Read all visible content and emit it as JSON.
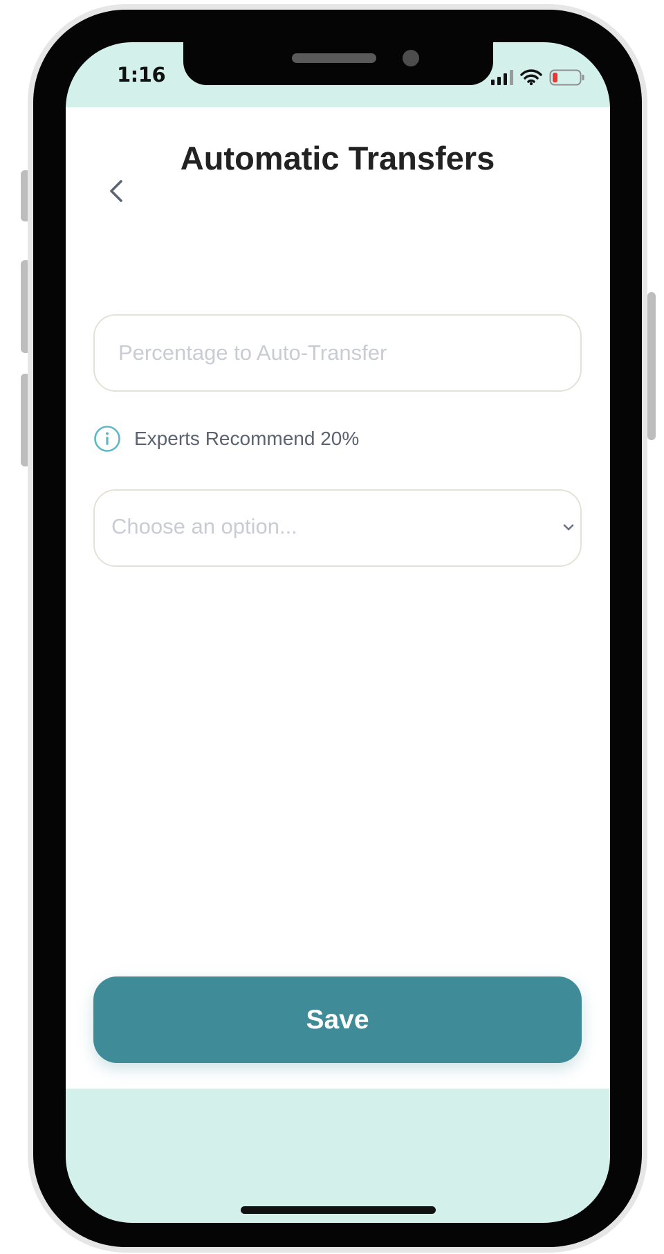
{
  "status_bar": {
    "time": "1:16",
    "icons": [
      "signal-icon",
      "wifi-icon",
      "battery-low-icon"
    ],
    "battery_color": "#e53935"
  },
  "header": {
    "back_icon": "chevron-left-icon",
    "title": "Automatic Transfers"
  },
  "form": {
    "percentage_field": {
      "placeholder": "Percentage to Auto-Transfer",
      "value": ""
    },
    "hint": {
      "icon": "info-icon",
      "text": "Experts Recommend 20%"
    },
    "option_select": {
      "placeholder": "Choose an option...",
      "icon": "chevron-down-icon"
    }
  },
  "actions": {
    "save_label": "Save"
  },
  "colors": {
    "accent": "#3f8b98",
    "screen_tint": "#d3f0eb",
    "info_icon": "#5cb8c7"
  }
}
